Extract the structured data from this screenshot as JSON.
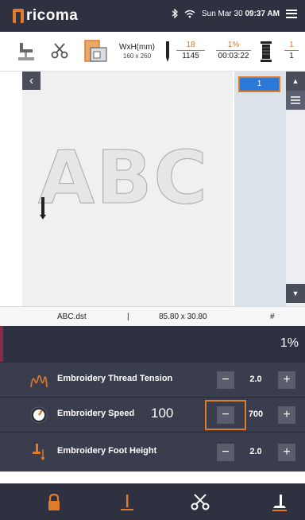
{
  "brand": {
    "logo": "ricoma"
  },
  "status": {
    "date": "Sun Mar 30",
    "time": "09:37 AM"
  },
  "toolbar": {
    "wxh_label": "WxH(mm)",
    "wxh_value": "160 x 260",
    "stitch_current": "18",
    "stitch_total": "1145",
    "progress_percent": "1%",
    "elapsed_time": "00:03:22",
    "spool_current": "1",
    "spool_total": "1"
  },
  "canvas": {
    "design_text": "ABC"
  },
  "layers": {
    "selected": "1"
  },
  "info": {
    "filename": "ABC.dst",
    "separator": "|",
    "dimensions": "85.80 x 30.80",
    "hash": "#"
  },
  "progress": {
    "value": 0.01,
    "text": "1%"
  },
  "settings": [
    {
      "label": "Embroidery Thread Tension",
      "value": "2.0",
      "icon": "thread-tension-icon"
    },
    {
      "label": "Embroidery Speed",
      "current": "100",
      "value": "700",
      "icon": "speed-dial-icon"
    },
    {
      "label": "Embroidery Foot Height",
      "value": "2.0",
      "icon": "foot-height-icon"
    }
  ],
  "buttons": {
    "minus": "−",
    "plus": "+",
    "back": "‹"
  },
  "colors": {
    "accent": "#e07b2a",
    "dark": "#2f3140",
    "row": "#3a3d4e",
    "selection": "#2b78d6"
  }
}
